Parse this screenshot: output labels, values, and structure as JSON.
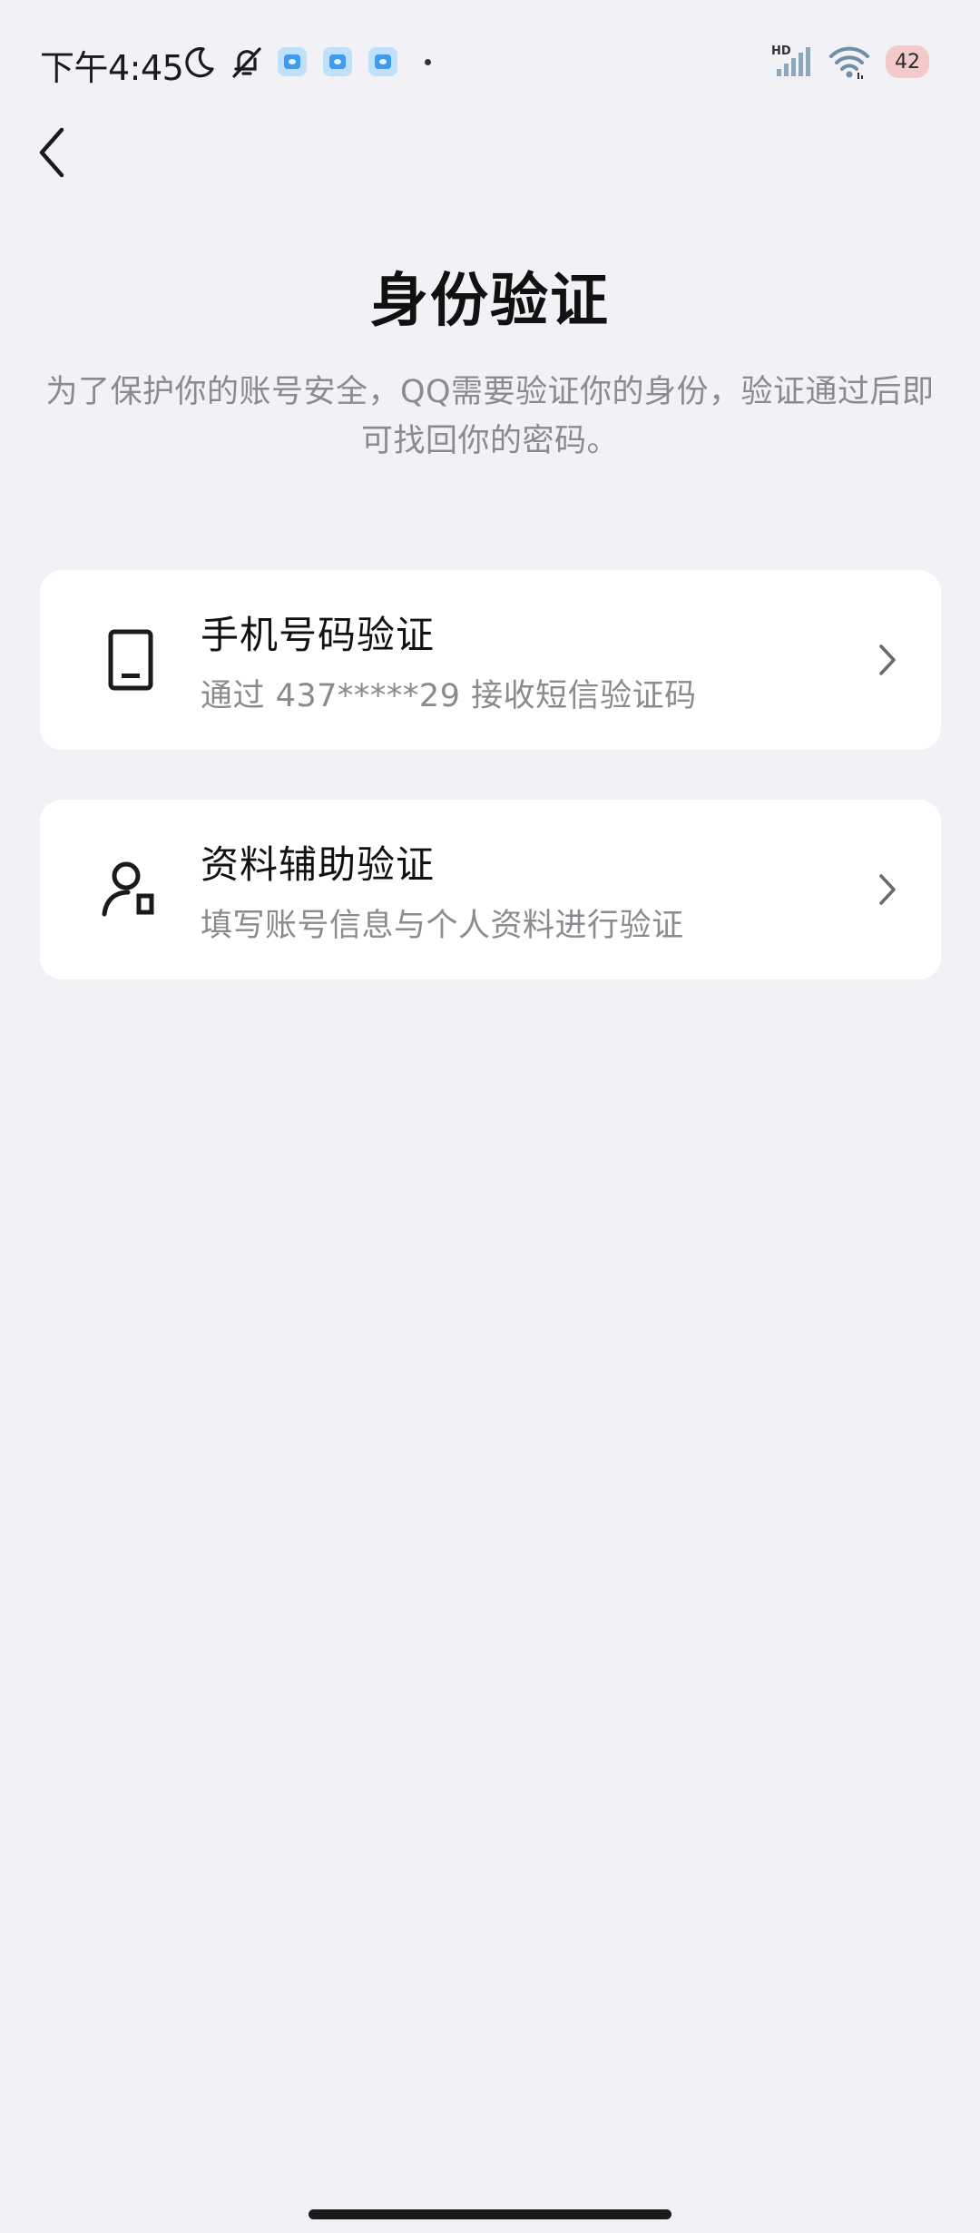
{
  "status_bar": {
    "time": "下午4:45",
    "battery_level": "42",
    "network_label": "HD",
    "icons": [
      "moon-icon",
      "bell-off-icon",
      "app-notification-icon",
      "app-notification-icon",
      "app-notification-icon",
      "signal-icon",
      "wifi-icon",
      "battery-icon"
    ]
  },
  "header": {
    "title": "身份验证",
    "description": "为了保护你的账号安全，QQ需要验证你的身份，验证通过后即可找回你的密码。"
  },
  "options": [
    {
      "title": "手机号码验证",
      "subtitle": "通过 437*****29 接收短信验证码",
      "icon": "phone-icon"
    },
    {
      "title": "资料辅助验证",
      "subtitle": "填写账号信息与个人资料进行验证",
      "icon": "user-info-icon"
    }
  ],
  "colors": {
    "background": "#f1f1f6",
    "card": "#ffffff",
    "primary_text": "#111111",
    "secondary_text": "#8a8a8f"
  }
}
